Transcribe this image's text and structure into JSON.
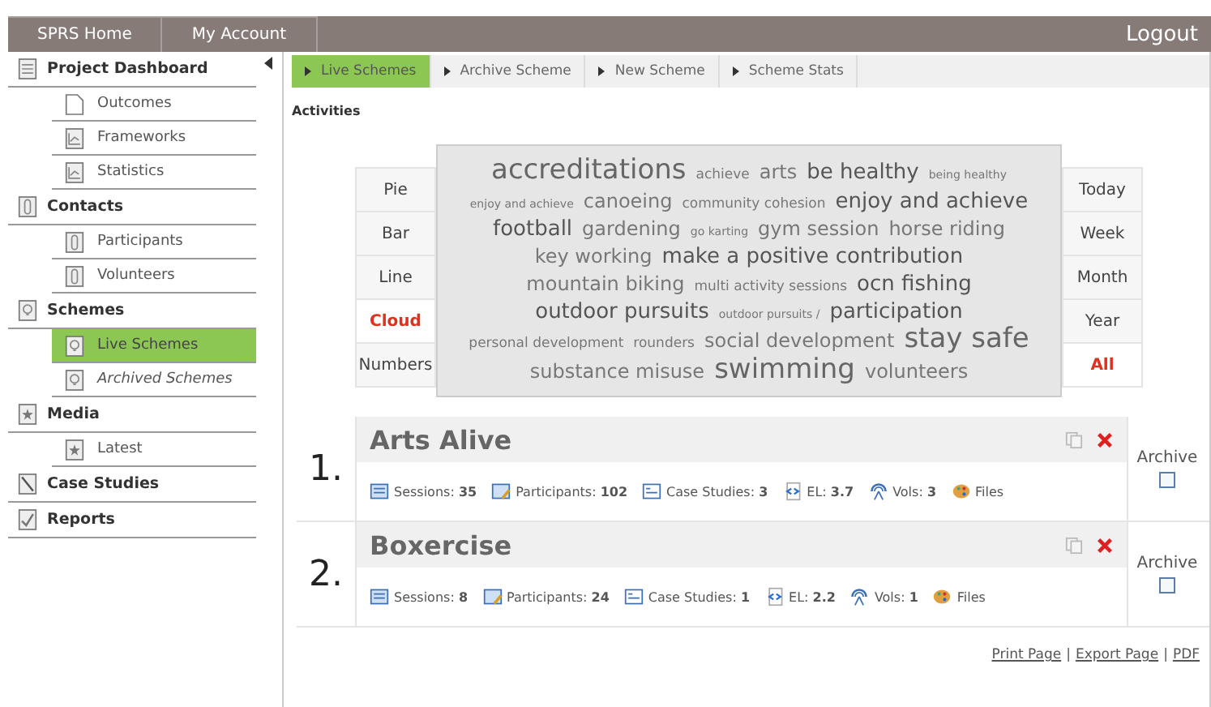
{
  "top_nav": {
    "tabs": [
      {
        "label": "SPRS Home",
        "selected": false
      },
      {
        "label": "My Account",
        "selected": false
      }
    ],
    "logout": "Logout"
  },
  "sidebar": {
    "sections": [
      {
        "label": "Project Dashboard",
        "kind": "doc",
        "children": [
          {
            "label": "Outcomes",
            "kind": "page",
            "selected": false,
            "italic": false
          },
          {
            "label": "Frameworks",
            "kind": "chart",
            "selected": false,
            "italic": false
          },
          {
            "label": "Statistics",
            "kind": "chart",
            "selected": false,
            "italic": false
          }
        ]
      },
      {
        "label": "Contacts",
        "kind": "clip",
        "children": [
          {
            "label": "Participants",
            "kind": "clip",
            "selected": false,
            "italic": false
          },
          {
            "label": "Volunteers",
            "kind": "clip",
            "selected": false,
            "italic": false
          }
        ]
      },
      {
        "label": "Schemes",
        "kind": "bulb",
        "children": [
          {
            "label": "Live Schemes",
            "kind": "bulb",
            "selected": true,
            "italic": false
          },
          {
            "label": "Archived Schemes",
            "kind": "bulb",
            "selected": false,
            "italic": true
          }
        ]
      },
      {
        "label": "Media",
        "kind": "star",
        "children": [
          {
            "label": "Latest",
            "kind": "star",
            "selected": false,
            "italic": false
          }
        ]
      },
      {
        "label": "Case Studies",
        "kind": "pen"
      },
      {
        "label": "Reports",
        "kind": "check"
      }
    ]
  },
  "sub_tabs": [
    {
      "label": "Live Schemes",
      "selected": true
    },
    {
      "label": "Archive Scheme",
      "selected": false
    },
    {
      "label": "New Scheme",
      "selected": false
    },
    {
      "label": "Scheme Stats",
      "selected": false
    }
  ],
  "heading": "Activities",
  "chart_types": [
    {
      "label": "Pie",
      "selected": false
    },
    {
      "label": "Bar",
      "selected": false
    },
    {
      "label": "Line",
      "selected": false
    },
    {
      "label": "Cloud",
      "selected": true
    },
    {
      "label": "Numbers",
      "selected": false
    }
  ],
  "periods": [
    {
      "label": "Today",
      "selected": false
    },
    {
      "label": "Week",
      "selected": false
    },
    {
      "label": "Month",
      "selected": false
    },
    {
      "label": "Year",
      "selected": false
    },
    {
      "label": "All",
      "selected": true
    }
  ],
  "word_cloud": [
    {
      "word": "accreditations",
      "kind": "xl"
    },
    {
      "word": "achieve",
      "kind": "s"
    },
    {
      "word": "arts",
      "kind": "m"
    },
    {
      "word": "be healthy",
      "kind": "l"
    },
    {
      "word": "being healthy",
      "kind": "xs"
    },
    {
      "word": "enjoy and achieve",
      "kind": "xs"
    },
    {
      "word": "canoeing",
      "kind": "m"
    },
    {
      "word": "community cohesion",
      "kind": "s"
    },
    {
      "word": "enjoy and achieve",
      "kind": "l"
    },
    {
      "word": "football",
      "kind": "l"
    },
    {
      "word": "gardening",
      "kind": "m"
    },
    {
      "word": "go karting",
      "kind": "xs"
    },
    {
      "word": "gym session",
      "kind": "m"
    },
    {
      "word": "horse riding",
      "kind": "m"
    },
    {
      "word": "key working",
      "kind": "m"
    },
    {
      "word": "make a positive contribution",
      "kind": "l"
    },
    {
      "word": "mountain biking",
      "kind": "m"
    },
    {
      "word": "multi activity sessions",
      "kind": "s"
    },
    {
      "word": "ocn fishing",
      "kind": "l"
    },
    {
      "word": "outdoor pursuits",
      "kind": "l"
    },
    {
      "word": "outdoor pursuits /",
      "kind": "xs"
    },
    {
      "word": "participation",
      "kind": "l"
    },
    {
      "word": "personal development",
      "kind": "s"
    },
    {
      "word": "rounders",
      "kind": "s"
    },
    {
      "word": "social development",
      "kind": "m"
    },
    {
      "word": "stay safe",
      "kind": "xl"
    },
    {
      "word": "substance misuse",
      "kind": "m"
    },
    {
      "word": "swimming",
      "kind": "xl"
    },
    {
      "word": "volunteers",
      "kind": "m"
    }
  ],
  "schemes": [
    {
      "number": "1.",
      "title": "Arts Alive",
      "archive_label": "Archive",
      "archived": false,
      "stats": [
        {
          "kind": "sessions",
          "text": "Sessions: **35**"
        },
        {
          "kind": "participants",
          "text": "Participants: **102**"
        },
        {
          "kind": "case",
          "text": "Case Studies: **3**"
        },
        {
          "kind": "el",
          "text": "EL: **3.7**"
        },
        {
          "kind": "vols",
          "text": "Vols: **3**"
        },
        {
          "kind": "files",
          "text": "Files"
        }
      ]
    },
    {
      "number": "2.",
      "title": "Boxercise",
      "archive_label": "Archive",
      "archived": false,
      "stats": [
        {
          "kind": "sessions",
          "text": "Sessions: **8**"
        },
        {
          "kind": "participants",
          "text": "Participants: **24**"
        },
        {
          "kind": "case",
          "text": "Case Studies: **1**"
        },
        {
          "kind": "el",
          "text": "EL: **2.2**"
        },
        {
          "kind": "vols",
          "text": "Vols: **1**"
        },
        {
          "kind": "files",
          "text": "Files"
        }
      ]
    }
  ],
  "footer": [
    {
      "kind": "link",
      "text": "Print Page"
    },
    {
      "kind": "separator",
      "text": "|"
    },
    {
      "kind": "link",
      "text": "Export Page"
    },
    {
      "kind": "separator",
      "text": "|"
    },
    {
      "kind": "link",
      "text": "PDF"
    }
  ]
}
